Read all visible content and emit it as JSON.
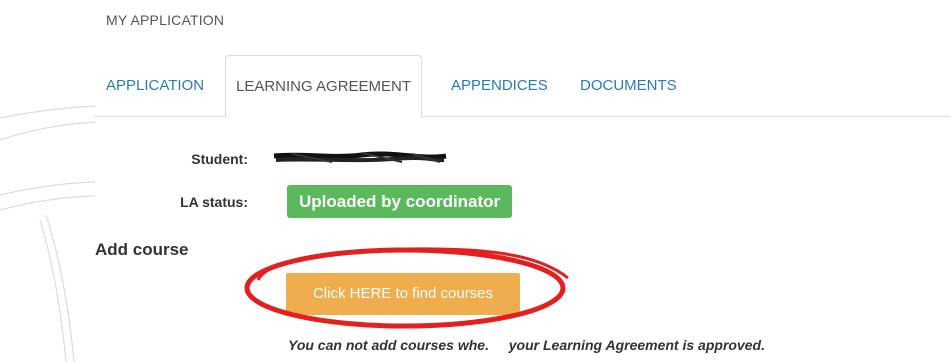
{
  "header": {
    "section_title": "MY APPLICATION"
  },
  "tabs": [
    {
      "label": "APPLICATION",
      "active": false
    },
    {
      "label": "LEARNING AGREEMENT",
      "active": true
    },
    {
      "label": "APPENDICES",
      "active": false
    },
    {
      "label": "DOCUMENTS",
      "active": false
    }
  ],
  "student": {
    "label": "Student:"
  },
  "la_status": {
    "label": "LA status:",
    "value": "Uploaded by coordinator",
    "color": "#5cb85c"
  },
  "add_course": {
    "heading": "Add course",
    "button_label": "Click HERE to find courses",
    "button_color": "#f0ad4e",
    "notice_before": "You can not add courses whe.",
    "notice_after": "your Learning Agreement is approved."
  },
  "annotation": {
    "color": "#e32020"
  },
  "colors": {
    "link": "#2a7ab8"
  }
}
